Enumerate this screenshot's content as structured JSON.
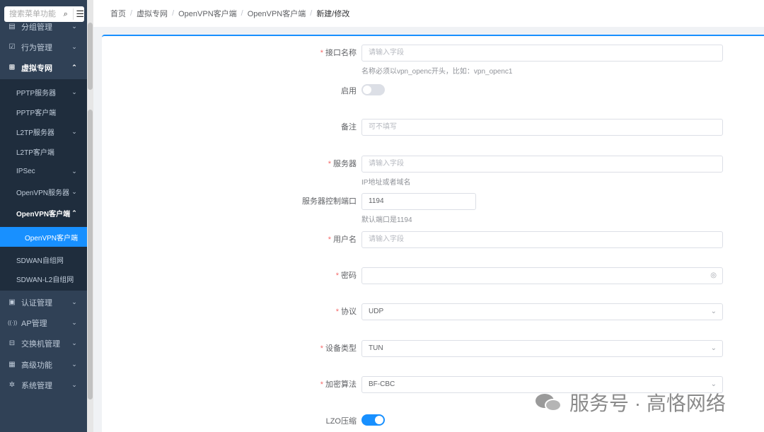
{
  "sidebar": {
    "search_placeholder": "搜索菜单功能",
    "items": [
      {
        "label": "分组管理",
        "icon": "group-icon",
        "glyph": "▤",
        "chev": "⌄"
      },
      {
        "label": "行为管理",
        "icon": "behavior-icon",
        "glyph": "☑",
        "chev": "⌄"
      },
      {
        "label": "虚拟专网",
        "icon": "vpn-icon",
        "glyph": "⊞",
        "chev": "⌃"
      },
      {
        "label": "认证管理",
        "icon": "auth-icon",
        "glyph": "▣",
        "chev": "⌄"
      },
      {
        "label": "AP管理",
        "icon": "ap-icon",
        "glyph": "((·))",
        "chev": "⌄"
      },
      {
        "label": "交换机管理",
        "icon": "switch-icon",
        "glyph": "⊟",
        "chev": "⌄"
      },
      {
        "label": "高级功能",
        "icon": "advanced-icon",
        "glyph": "▦",
        "chev": "⌄"
      },
      {
        "label": "系统管理",
        "icon": "settings-icon",
        "glyph": "✲",
        "chev": "⌄"
      }
    ],
    "sub_items": [
      {
        "label": "PPTP服务器",
        "chev": "⌄"
      },
      {
        "label": "PPTP客户端",
        "chev": ""
      },
      {
        "label": "L2TP服务器",
        "chev": "⌄"
      },
      {
        "label": "L2TP客户端",
        "chev": ""
      },
      {
        "label": "IPSec",
        "chev": "⌄"
      },
      {
        "label": "OpenVPN服务器",
        "chev": "⌄"
      },
      {
        "label": "OpenVPN客户端",
        "chev": "⌃"
      },
      {
        "label": "SDWAN自组网",
        "chev": ""
      },
      {
        "label": "SDWAN-L2自组网",
        "chev": ""
      }
    ],
    "selected_leaf": "OpenVPN客户端"
  },
  "breadcrumb": [
    "首页",
    "虚拟专网",
    "OpenVPN客户端",
    "OpenVPN客户端",
    "新建/修改"
  ],
  "breadcrumb_sep": "/",
  "form": {
    "iface_name": {
      "label": "接口名称",
      "placeholder": "请输入字段",
      "hint": "名称必须以vpn_openc开头，比如：vpn_openc1"
    },
    "enable": {
      "label": "启用",
      "on": false
    },
    "remark": {
      "label": "备注",
      "placeholder": "可不填写"
    },
    "server": {
      "label": "服务器",
      "placeholder": "请输入字段",
      "hint": "IP地址或者域名"
    },
    "port": {
      "label": "服务器控制端口",
      "value": "1194",
      "hint": "默认端口是1194"
    },
    "username": {
      "label": "用户名",
      "placeholder": "请输入字段"
    },
    "password": {
      "label": "密码",
      "value": ""
    },
    "protocol": {
      "label": "协议",
      "value": "UDP"
    },
    "device_type": {
      "label": "设备类型",
      "value": "TUN"
    },
    "cipher": {
      "label": "加密算法",
      "value": "BF-CBC"
    },
    "lzo": {
      "label": "LZO压缩",
      "on": true
    }
  },
  "required_mark": "*",
  "watermark": "服务号 · 高恪网络",
  "colors": {
    "accent": "#1890ff",
    "sidebar_bg": "#304156",
    "submenu_bg": "#1f2d3d",
    "required": "#f56c6c"
  }
}
